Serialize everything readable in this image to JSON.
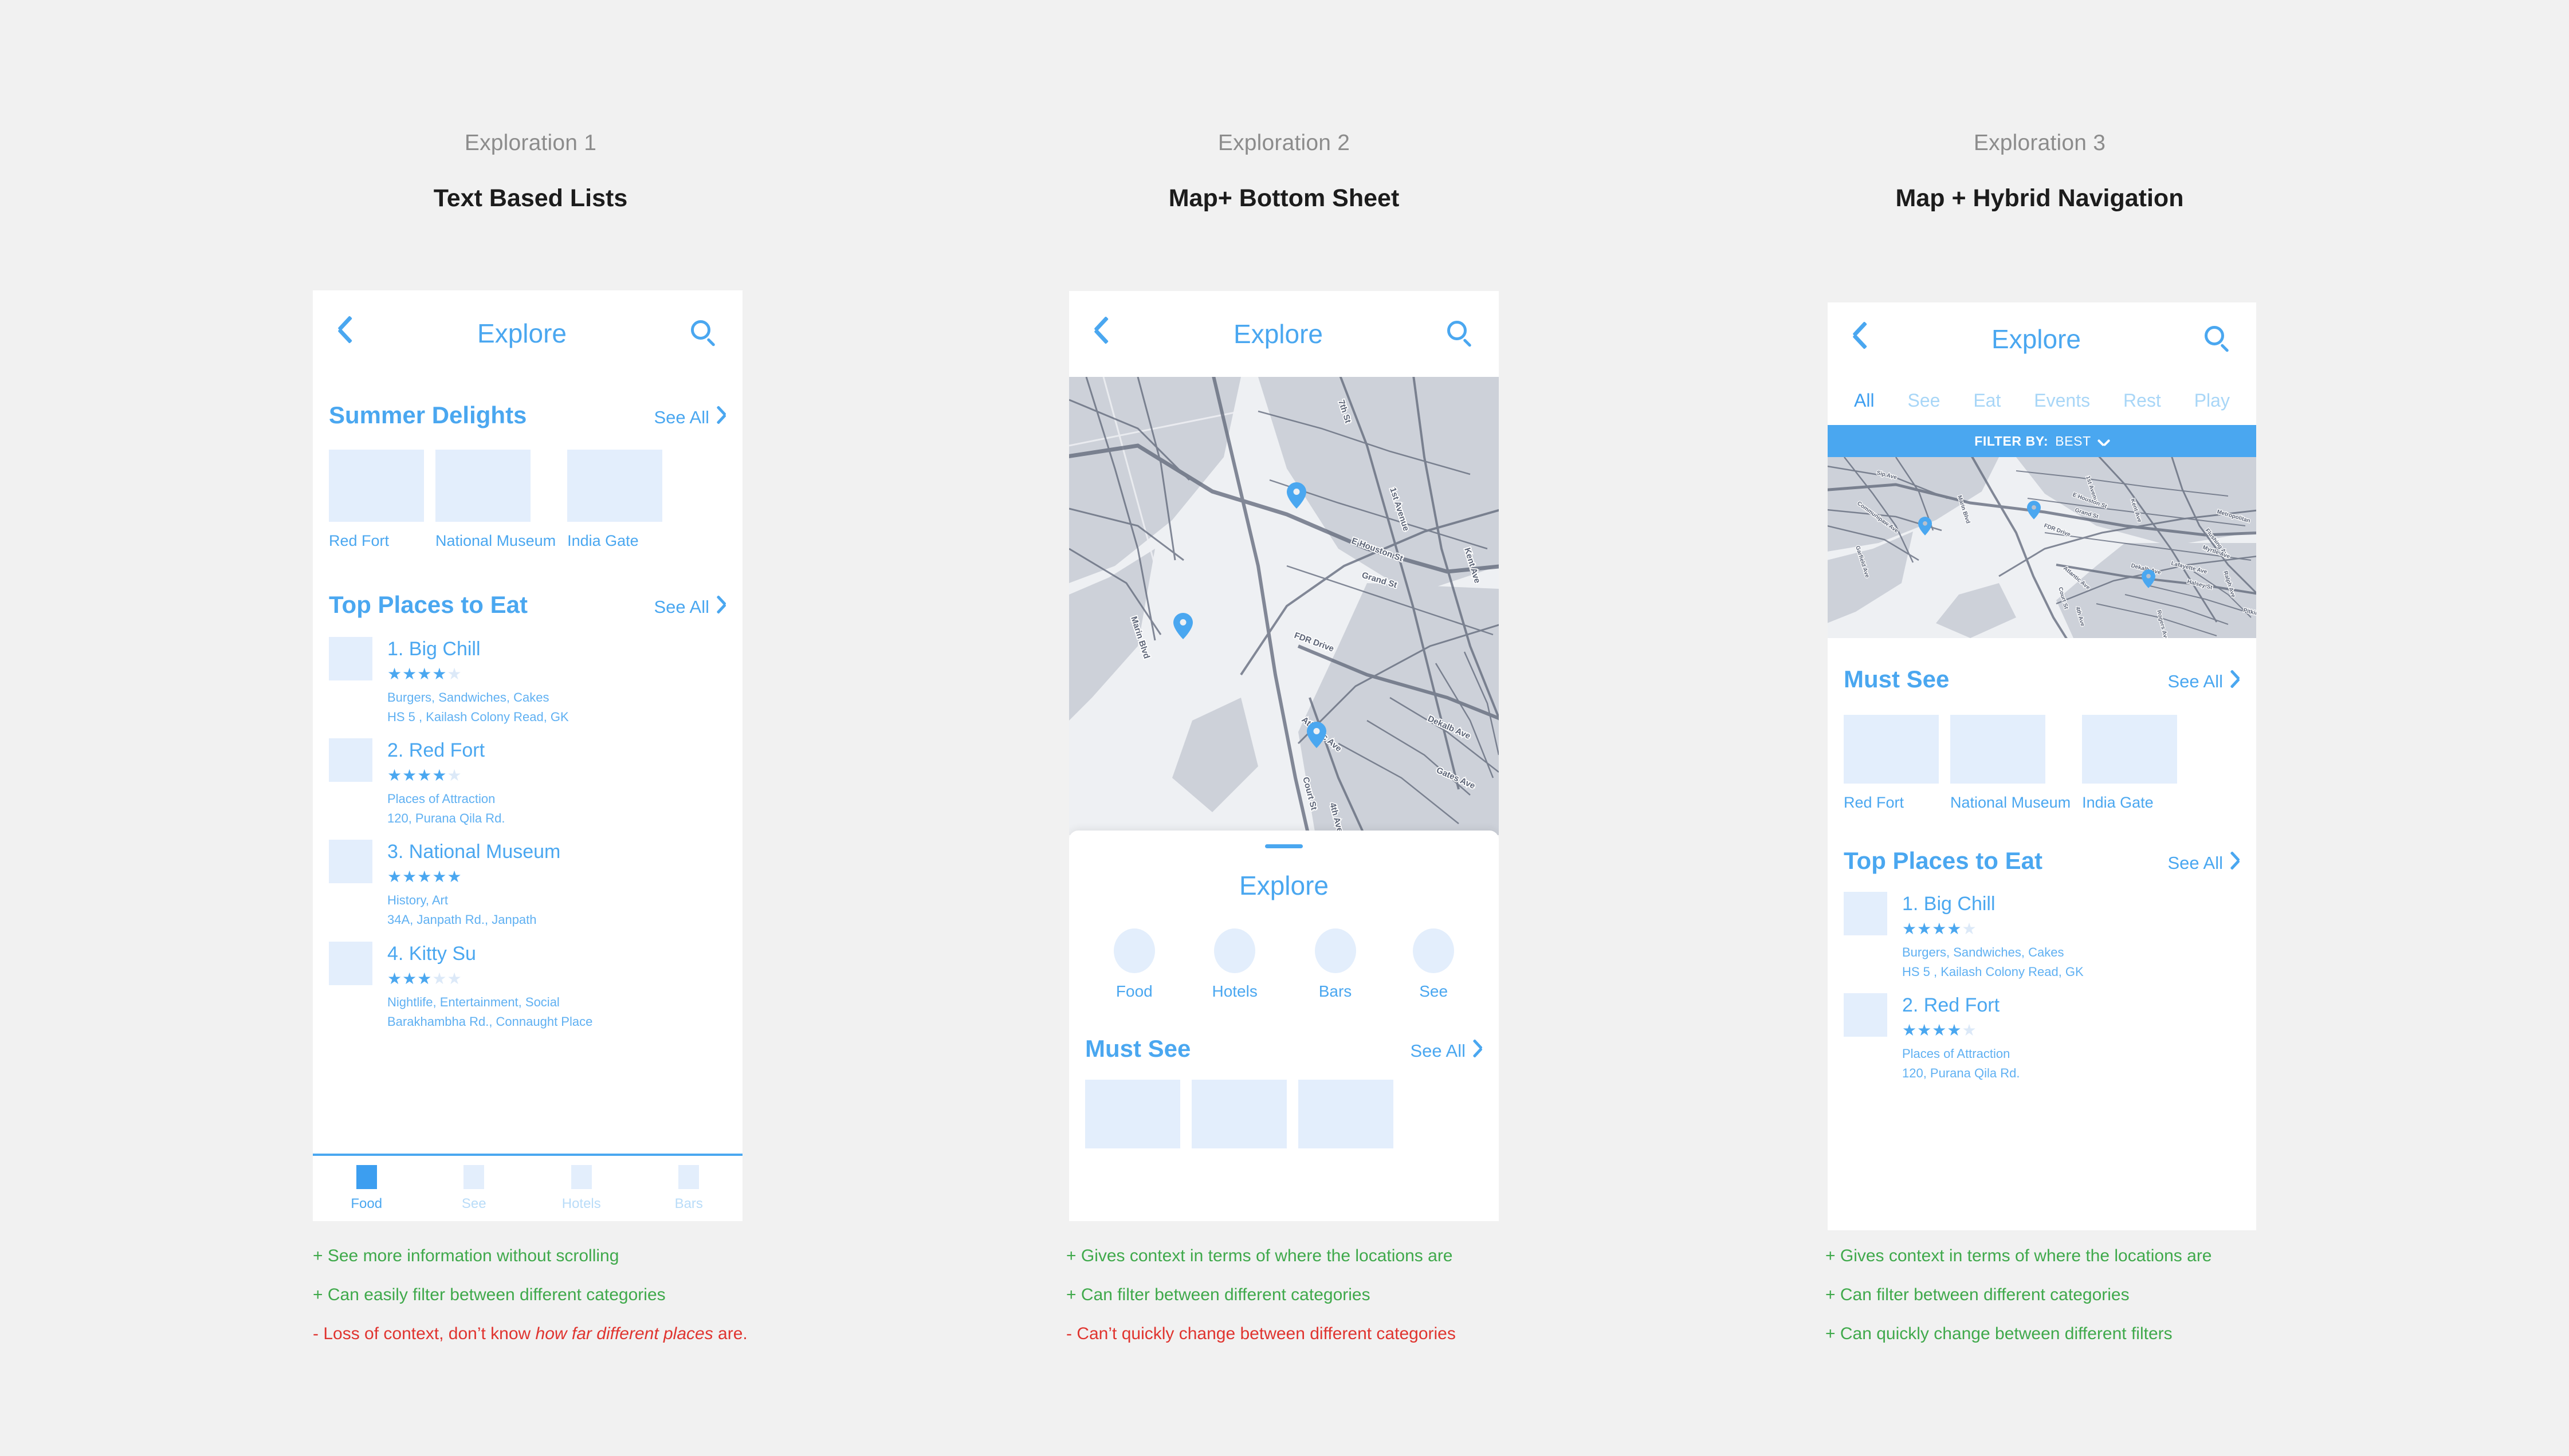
{
  "columns": [
    {
      "kicker": "Exploration 1",
      "title": "Text Based Lists"
    },
    {
      "kicker": "Exploration 2",
      "title": "Map+ Bottom Sheet"
    },
    {
      "kicker": "Exploration 3",
      "title": "Map + Hybrid Navigation"
    }
  ],
  "nav": {
    "title": "Explore",
    "back_icon": "chevron-left-icon",
    "search_icon": "search-icon"
  },
  "phone1": {
    "sections": [
      {
        "title": "Summer Delights",
        "see_all": "See All",
        "cards": [
          {
            "caption": "Red Fort"
          },
          {
            "caption": "National Museum"
          },
          {
            "caption": "India Gate"
          }
        ]
      },
      {
        "title": "Top Places to Eat",
        "see_all": "See All"
      }
    ],
    "places": [
      {
        "name": "1. Big Chill",
        "rating": 4,
        "max_rating": 5,
        "tags": "Burgers, Sandwiches, Cakes",
        "address": "HS 5 , Kailash Colony Read, GK"
      },
      {
        "name": "2. Red Fort",
        "rating": 4,
        "max_rating": 5,
        "tags": "Places of Attraction",
        "address": "120, Purana Qila Rd."
      },
      {
        "name": "3. National Museum",
        "rating": 5,
        "max_rating": 5,
        "tags": "History, Art",
        "address": "34A,  Janpath Rd., Janpath"
      },
      {
        "name": "4. Kitty Su",
        "rating": 3,
        "max_rating": 5,
        "tags": "Nightlife, Entertainment, Social",
        "address": "Barakhambha Rd., Connaught Place"
      }
    ],
    "tabbar": [
      {
        "label": "Food",
        "active": true
      },
      {
        "label": "See",
        "active": false
      },
      {
        "label": "Hotels",
        "active": false
      },
      {
        "label": "Bars",
        "active": false
      }
    ]
  },
  "phone2": {
    "map": {
      "pins": 3,
      "street_labels": [
        "Marin Blvd",
        "1st Avenue",
        "E Houston St",
        "Grand St",
        "Kent Ave",
        "FDR Drive",
        "Atlantic Ave",
        "Court St",
        "4th Ave",
        "Dekalb Ave",
        "Gates Ave",
        "7th St"
      ]
    },
    "sheet": {
      "title": "Explore",
      "categories": [
        {
          "label": "Food"
        },
        {
          "label": "Hotels"
        },
        {
          "label": "Bars"
        },
        {
          "label": "See"
        }
      ],
      "section": {
        "title": "Must See",
        "see_all": "See All"
      }
    }
  },
  "phone3": {
    "tabs": [
      {
        "label": "All",
        "active": true
      },
      {
        "label": "See",
        "active": false
      },
      {
        "label": "Eat",
        "active": false
      },
      {
        "label": "Events",
        "active": false
      },
      {
        "label": "Rest",
        "active": false
      },
      {
        "label": "Play",
        "active": false
      }
    ],
    "filter": {
      "prefix": "FILTER BY:",
      "value": "BEST",
      "caret_icon": "chevron-down-icon"
    },
    "map": {
      "pins": 3,
      "street_labels": [
        "Sip Ave",
        "Communipaw Ave",
        "Marin Blvd",
        "Garfield Ave",
        "1st Avenue",
        "E Houston St",
        "Grand St",
        "Kent Ave",
        "FDR Drive",
        "Metropolitan",
        "Flushing Ave",
        "Myrtle Ave",
        "Dekalb Ave",
        "Lafayette Ave",
        "Halsey St",
        "Ralph Ave",
        "Atlantic Ave",
        "Court St",
        "4th Ave",
        "Rogers Ave",
        "Pitkin"
      ]
    },
    "sections": [
      {
        "title": "Must See",
        "see_all": "See All",
        "cards": [
          {
            "caption": "Red Fort"
          },
          {
            "caption": "National Museum"
          },
          {
            "caption": "India Gate"
          }
        ]
      },
      {
        "title": "Top Places to Eat",
        "see_all": "See All"
      }
    ],
    "places": [
      {
        "name": "1. Big Chill",
        "rating": 4,
        "max_rating": 5,
        "tags": "Burgers, Sandwiches, Cakes",
        "address": "HS 5 , Kailash Colony Read, GK"
      },
      {
        "name": "2. Red Fort",
        "rating": 4,
        "max_rating": 5,
        "tags": "Places of Attraction",
        "address": "120, Purana Qila Rd."
      }
    ]
  },
  "annotations": {
    "col1": [
      {
        "text": "+ See more information without scrolling",
        "kind": "pos"
      },
      {
        "text": "+ Can easily filter between different categories",
        "kind": "pos"
      },
      {
        "text": "- Loss of context, don’t know how far different places are.",
        "kind": "neg",
        "italic_part": "how far different places"
      }
    ],
    "col2": [
      {
        "text": "+ Gives context in terms of where the locations are",
        "kind": "pos"
      },
      {
        "text": "+ Can filter between different categories",
        "kind": "pos"
      },
      {
        "text": "- Can’t quickly change between different categories",
        "kind": "neg"
      }
    ],
    "col3": [
      {
        "text": "+ Gives context in terms of where the locations are",
        "kind": "pos"
      },
      {
        "text": "+ Can filter between different categories",
        "kind": "pos"
      },
      {
        "text": "+ Can quickly change between different filters",
        "kind": "pos"
      }
    ]
  },
  "colors": {
    "accent": "#4aa7f0",
    "accent_strong": "#3c9ef0",
    "placeholder": "#e3eefc",
    "positive": "#3fa94b",
    "negative": "#e0342f",
    "page_bg": "#f1f1f1"
  }
}
